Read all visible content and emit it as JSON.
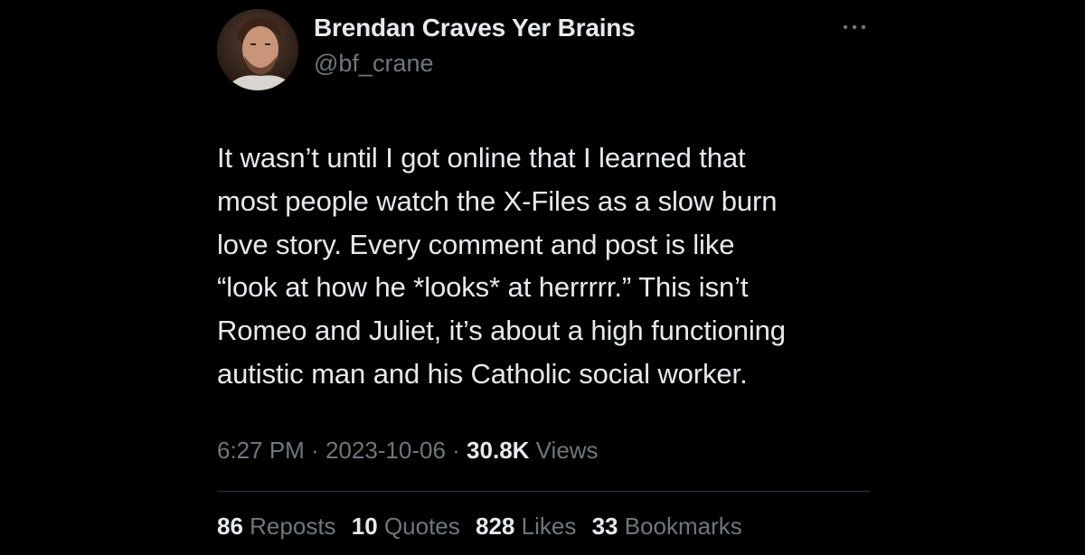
{
  "author": {
    "display_name": "Brendan Craves Yer Brains",
    "handle": "@bf_crane"
  },
  "tweet": {
    "lines": [
      "It wasn’t until I got online that I learned that",
      "most people watch the X-Files as a slow burn",
      "love story. Every comment and post is like",
      "“look at how he *looks* at herrrrr.” This isn’t",
      "Romeo and Juliet, it’s about a high functioning",
      "autistic man and his Catholic social worker."
    ]
  },
  "meta": {
    "time": "6:27 PM",
    "separator": " · ",
    "date": "2023-10-06",
    "views_count": "30.8K",
    "views_label": "Views"
  },
  "stats": {
    "reposts_count": "86",
    "reposts_label": "Reposts",
    "quotes_count": "10",
    "quotes_label": "Quotes",
    "likes_count": "828",
    "likes_label": "Likes",
    "bookmarks_count": "33",
    "bookmarks_label": "Bookmarks"
  },
  "icons": {
    "more": "more-horizontal-icon"
  },
  "colors": {
    "background": "#000000",
    "primary_text": "#e7e9ea",
    "secondary_text": "#71767b",
    "divider": "#2f3336"
  }
}
